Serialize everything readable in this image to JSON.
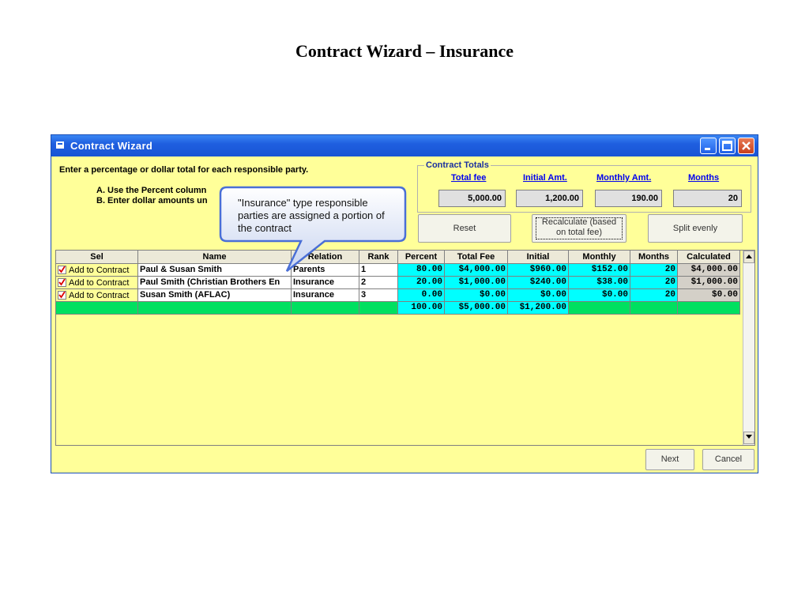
{
  "slide": {
    "title": "Contract Wizard – Insurance"
  },
  "window": {
    "title": "Contract Wizard",
    "instructions": {
      "line1": "Enter a percentage or dollar total for each responsible party.",
      "line2": "A. Use the Percent column",
      "line3": "B. Enter dollar amounts un"
    }
  },
  "totals": {
    "legend": "Contract Totals",
    "headers": [
      "Total fee",
      "Initial Amt.",
      "Monthly Amt.",
      "Months"
    ],
    "values": [
      "5,000.00",
      "1,200.00",
      "190.00",
      "20"
    ]
  },
  "buttons": {
    "reset": "Reset",
    "recalc_line1": "Recalculate (based",
    "recalc_line2": "on total fee)",
    "split": "Split evenly",
    "next": "Next",
    "cancel": "Cancel"
  },
  "grid": {
    "columns": [
      "Sel",
      "Name",
      "Relation",
      "Rank",
      "Percent",
      "Total Fee",
      "Initial",
      "Monthly",
      "Months",
      "Calculated"
    ],
    "rows": [
      {
        "sel": "Add to Contract",
        "name": "Paul & Susan Smith",
        "relation": "Parents",
        "rank": "1",
        "percent": "80.00",
        "total_fee": "$4,000.00",
        "initial": "$960.00",
        "monthly": "$152.00",
        "months": "20",
        "calculated": "$4,000.00"
      },
      {
        "sel": "Add to Contract",
        "name": "Paul Smith (Christian Brothers En",
        "relation": "Insurance",
        "rank": "2",
        "percent": "20.00",
        "total_fee": "$1,000.00",
        "initial": "$240.00",
        "monthly": "$38.00",
        "months": "20",
        "calculated": "$1,000.00"
      },
      {
        "sel": "Add to Contract",
        "name": "Susan Smith (AFLAC)",
        "relation": "Insurance",
        "rank": "3",
        "percent": "0.00",
        "total_fee": "$0.00",
        "initial": "$0.00",
        "monthly": "$0.00",
        "months": "20",
        "calculated": "$0.00"
      }
    ],
    "totals_row": {
      "percent": "100.00",
      "total_fee": "$5,000.00",
      "initial": "$1,200.00"
    }
  },
  "callout": {
    "text": "\"Insurance\" type responsible parties are assigned a portion of the contract"
  },
  "colors": {
    "window_bg": "#ffff99",
    "titlebar": "#1f5fe0",
    "cyan_cells": "#00ffff",
    "totals_row": "#00e060",
    "link": "#0000ee"
  },
  "icons": [
    "app-icon",
    "minimize-icon",
    "maximize-icon",
    "close-icon",
    "checkbox-checked-icon",
    "scroll-up-icon",
    "scroll-down-icon"
  ]
}
